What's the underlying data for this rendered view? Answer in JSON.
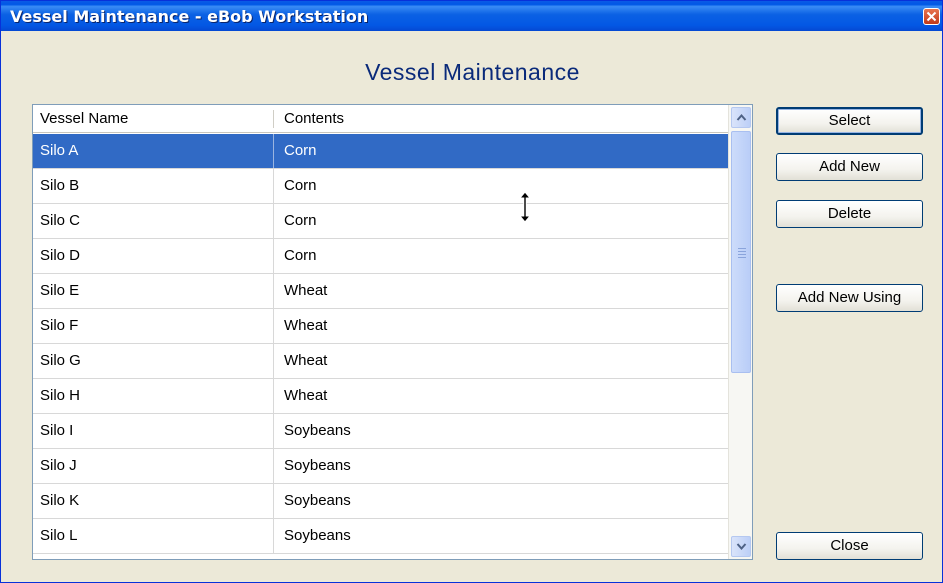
{
  "window": {
    "title": "Vessel Maintenance - eBob Workstation"
  },
  "heading": "Vessel Maintenance",
  "grid": {
    "columns": [
      "Vessel Name",
      "Contents"
    ],
    "selected_index": 0,
    "rows": [
      {
        "name": "Silo A",
        "contents": "Corn"
      },
      {
        "name": "Silo B",
        "contents": "Corn"
      },
      {
        "name": "Silo C",
        "contents": "Corn"
      },
      {
        "name": "Silo D",
        "contents": "Corn"
      },
      {
        "name": "Silo E",
        "contents": "Wheat"
      },
      {
        "name": "Silo F",
        "contents": "Wheat"
      },
      {
        "name": "Silo G",
        "contents": "Wheat"
      },
      {
        "name": "Silo H",
        "contents": "Wheat"
      },
      {
        "name": "Silo I",
        "contents": "Soybeans"
      },
      {
        "name": "Silo J",
        "contents": "Soybeans"
      },
      {
        "name": "Silo K",
        "contents": "Soybeans"
      },
      {
        "name": "Silo L",
        "contents": "Soybeans"
      }
    ]
  },
  "buttons": {
    "select": "Select",
    "add_new": "Add New",
    "delete": "Delete",
    "add_new_using": "Add New Using",
    "close": "Close"
  },
  "colors": {
    "title_bar": "#0058e6",
    "selection": "#316ac5",
    "heading": "#0a2a7a",
    "window_bg": "#ece9d8"
  },
  "icons": {
    "title_close": "close-icon",
    "scroll_up": "chevron-up-icon",
    "scroll_down": "chevron-down-icon",
    "cursor": "resize-vertical-cursor-icon"
  }
}
